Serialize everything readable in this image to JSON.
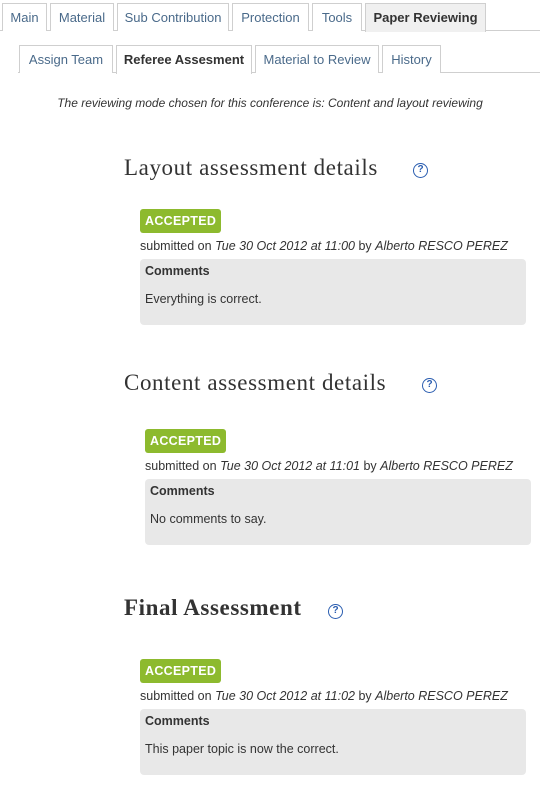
{
  "tabs": [
    "Main",
    "Material",
    "Sub Contribution",
    "Protection",
    "Tools",
    "Paper Reviewing"
  ],
  "subtabs": [
    "Assign Team",
    "Referee Assesment",
    "Material to Review",
    "History"
  ],
  "mode_note": "The reviewing mode chosen for this conference is: Content and layout reviewing",
  "help_glyph": "?",
  "sections": [
    {
      "title": "Layout assessment details",
      "status": "ACCEPTED",
      "submitted_prefix": "submitted on",
      "date": "Tue 30 Oct 2012 at 11:00",
      "by": "by",
      "author": "Alberto RESCO PEREZ",
      "comments_label": "Comments",
      "comment": "Everything is correct."
    },
    {
      "title": "Content assessment details",
      "status": "ACCEPTED",
      "submitted_prefix": "submitted on",
      "date": "Tue 30 Oct 2012 at 11:01",
      "by": "by",
      "author": "Alberto RESCO PEREZ",
      "comments_label": "Comments",
      "comment": "No comments to say."
    },
    {
      "title": "Final Assessment",
      "status": "ACCEPTED",
      "submitted_prefix": "submitted on",
      "date": "Tue 30 Oct 2012 at 11:02",
      "by": "by",
      "author": "Alberto RESCO PEREZ",
      "comments_label": "Comments",
      "comment": "This paper topic is now the correct."
    }
  ],
  "colors": {
    "accepted_badge": "#8dba2e",
    "tab_link": "#4a6a8a",
    "help_icon": "#2a5db0",
    "comment_box": "#e8e8e8"
  },
  "icons": {
    "help": "help-icon"
  }
}
